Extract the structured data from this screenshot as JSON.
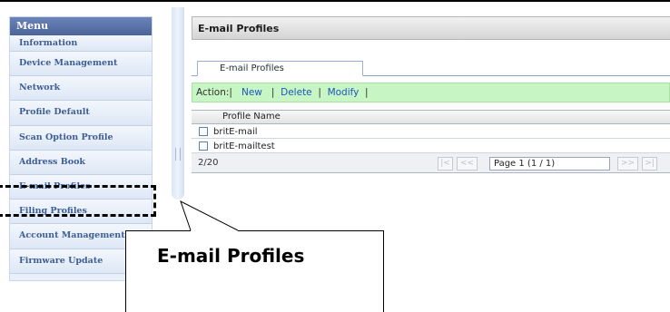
{
  "sidebar": {
    "header": "Menu",
    "items": [
      {
        "label": "Information"
      },
      {
        "label": "Device Management"
      },
      {
        "label": "Network"
      },
      {
        "label": "Profile Default"
      },
      {
        "label": "Scan Option Profile"
      },
      {
        "label": "Address Book"
      },
      {
        "label": "E-mail Profiles"
      },
      {
        "label": "Filing Profiles"
      },
      {
        "label": "Account Management"
      },
      {
        "label": "Firmware Update"
      }
    ]
  },
  "main": {
    "title": "E-mail Profiles",
    "tab_label": "E-mail Profiles",
    "action": {
      "label": "Action:|",
      "new": "New",
      "delete": "Delete",
      "modify": "Modify",
      "sep": "|"
    },
    "table": {
      "column_header": "Profile Name",
      "rows": [
        {
          "name": "britE-mail"
        },
        {
          "name": "britE-mailtest"
        }
      ]
    },
    "pager": {
      "count": "2/20",
      "first": "|<",
      "prev": "<<",
      "page_value": "Page 1 (1 / 1)",
      "next": ">>",
      "last": ">|"
    }
  },
  "callout": {
    "text": "E-mail Profiles"
  },
  "colors": {
    "menu_header": "#4c6599",
    "menu_text": "#3e5e95",
    "action_bar": "#c8f5c4",
    "link": "#1e53c0"
  }
}
